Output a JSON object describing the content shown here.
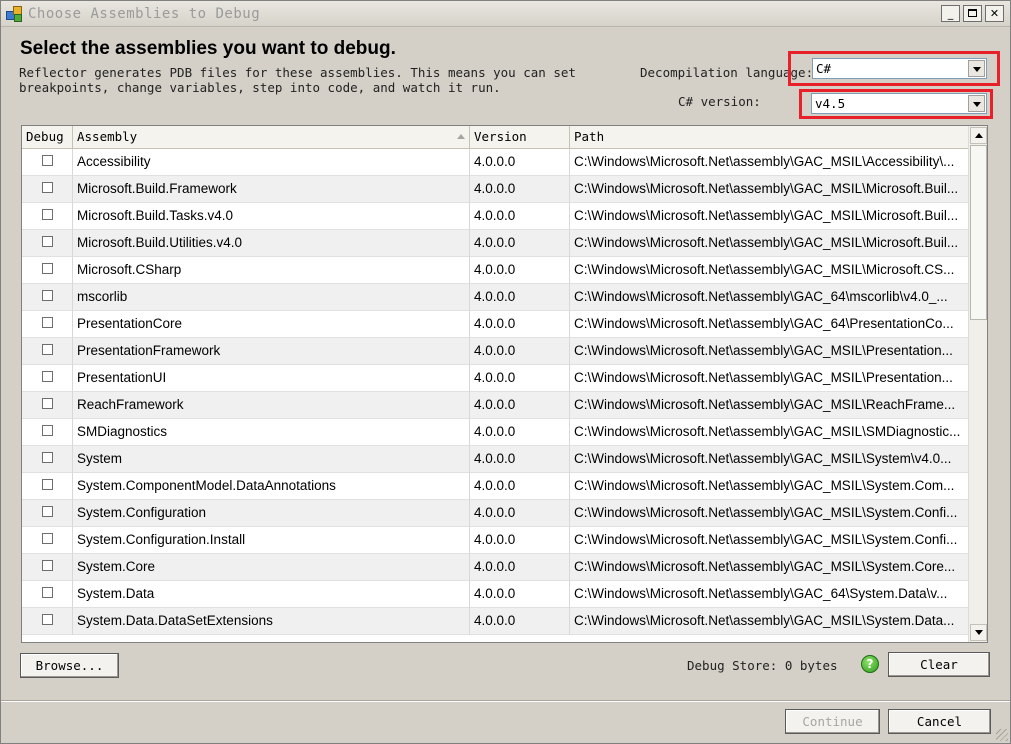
{
  "window": {
    "title": "Choose Assemblies to Debug",
    "buttons": {
      "minimize": "_",
      "maximize": "",
      "close": "✕"
    }
  },
  "header": {
    "heading": "Select the assemblies you want to debug.",
    "description": "Reflector generates PDB files for these assemblies. This means you can set breakpoints, change variables, step into code, and watch it run."
  },
  "options": {
    "language_label": "Decompilation language:",
    "language_value": "C#",
    "version_label": "C# version:",
    "version_value": "v4.5"
  },
  "table": {
    "columns": [
      "Debug",
      "Assembly",
      "Version",
      "Path"
    ],
    "sort_column": "Assembly",
    "rows": [
      {
        "debug": false,
        "assembly": "Accessibility",
        "version": "4.0.0.0",
        "path": "C:\\Windows\\Microsoft.Net\\assembly\\GAC_MSIL\\Accessibility\\..."
      },
      {
        "debug": false,
        "assembly": "Microsoft.Build.Framework",
        "version": "4.0.0.0",
        "path": "C:\\Windows\\Microsoft.Net\\assembly\\GAC_MSIL\\Microsoft.Buil..."
      },
      {
        "debug": false,
        "assembly": "Microsoft.Build.Tasks.v4.0",
        "version": "4.0.0.0",
        "path": "C:\\Windows\\Microsoft.Net\\assembly\\GAC_MSIL\\Microsoft.Buil..."
      },
      {
        "debug": false,
        "assembly": "Microsoft.Build.Utilities.v4.0",
        "version": "4.0.0.0",
        "path": "C:\\Windows\\Microsoft.Net\\assembly\\GAC_MSIL\\Microsoft.Buil..."
      },
      {
        "debug": false,
        "assembly": "Microsoft.CSharp",
        "version": "4.0.0.0",
        "path": "C:\\Windows\\Microsoft.Net\\assembly\\GAC_MSIL\\Microsoft.CS..."
      },
      {
        "debug": false,
        "assembly": "mscorlib",
        "version": "4.0.0.0",
        "path": "C:\\Windows\\Microsoft.Net\\assembly\\GAC_64\\mscorlib\\v4.0_..."
      },
      {
        "debug": false,
        "assembly": "PresentationCore",
        "version": "4.0.0.0",
        "path": "C:\\Windows\\Microsoft.Net\\assembly\\GAC_64\\PresentationCo..."
      },
      {
        "debug": false,
        "assembly": "PresentationFramework",
        "version": "4.0.0.0",
        "path": "C:\\Windows\\Microsoft.Net\\assembly\\GAC_MSIL\\Presentation..."
      },
      {
        "debug": false,
        "assembly": "PresentationUI",
        "version": "4.0.0.0",
        "path": "C:\\Windows\\Microsoft.Net\\assembly\\GAC_MSIL\\Presentation..."
      },
      {
        "debug": false,
        "assembly": "ReachFramework",
        "version": "4.0.0.0",
        "path": "C:\\Windows\\Microsoft.Net\\assembly\\GAC_MSIL\\ReachFrame..."
      },
      {
        "debug": false,
        "assembly": "SMDiagnostics",
        "version": "4.0.0.0",
        "path": "C:\\Windows\\Microsoft.Net\\assembly\\GAC_MSIL\\SMDiagnostic..."
      },
      {
        "debug": false,
        "assembly": "System",
        "version": "4.0.0.0",
        "path": "C:\\Windows\\Microsoft.Net\\assembly\\GAC_MSIL\\System\\v4.0..."
      },
      {
        "debug": false,
        "assembly": "System.ComponentModel.DataAnnotations",
        "version": "4.0.0.0",
        "path": "C:\\Windows\\Microsoft.Net\\assembly\\GAC_MSIL\\System.Com..."
      },
      {
        "debug": false,
        "assembly": "System.Configuration",
        "version": "4.0.0.0",
        "path": "C:\\Windows\\Microsoft.Net\\assembly\\GAC_MSIL\\System.Confi..."
      },
      {
        "debug": false,
        "assembly": "System.Configuration.Install",
        "version": "4.0.0.0",
        "path": "C:\\Windows\\Microsoft.Net\\assembly\\GAC_MSIL\\System.Confi..."
      },
      {
        "debug": false,
        "assembly": "System.Core",
        "version": "4.0.0.0",
        "path": "C:\\Windows\\Microsoft.Net\\assembly\\GAC_MSIL\\System.Core..."
      },
      {
        "debug": false,
        "assembly": "System.Data",
        "version": "4.0.0.0",
        "path": "C:\\Windows\\Microsoft.Net\\assembly\\GAC_64\\System.Data\\v..."
      },
      {
        "debug": false,
        "assembly": "System.Data.DataSetExtensions",
        "version": "4.0.0.0",
        "path": "C:\\Windows\\Microsoft.Net\\assembly\\GAC_MSIL\\System.Data..."
      }
    ]
  },
  "footer": {
    "browse_label": "Browse...",
    "store_label": "Debug Store: 0 bytes",
    "help_glyph": "?",
    "clear_label": "Clear",
    "continue_label": "Continue",
    "cancel_label": "Cancel"
  },
  "colors": {
    "highlight_box": "#e8202a",
    "dialog_bg": "#d4d0c8",
    "row_alt": "#f0f0f0"
  }
}
